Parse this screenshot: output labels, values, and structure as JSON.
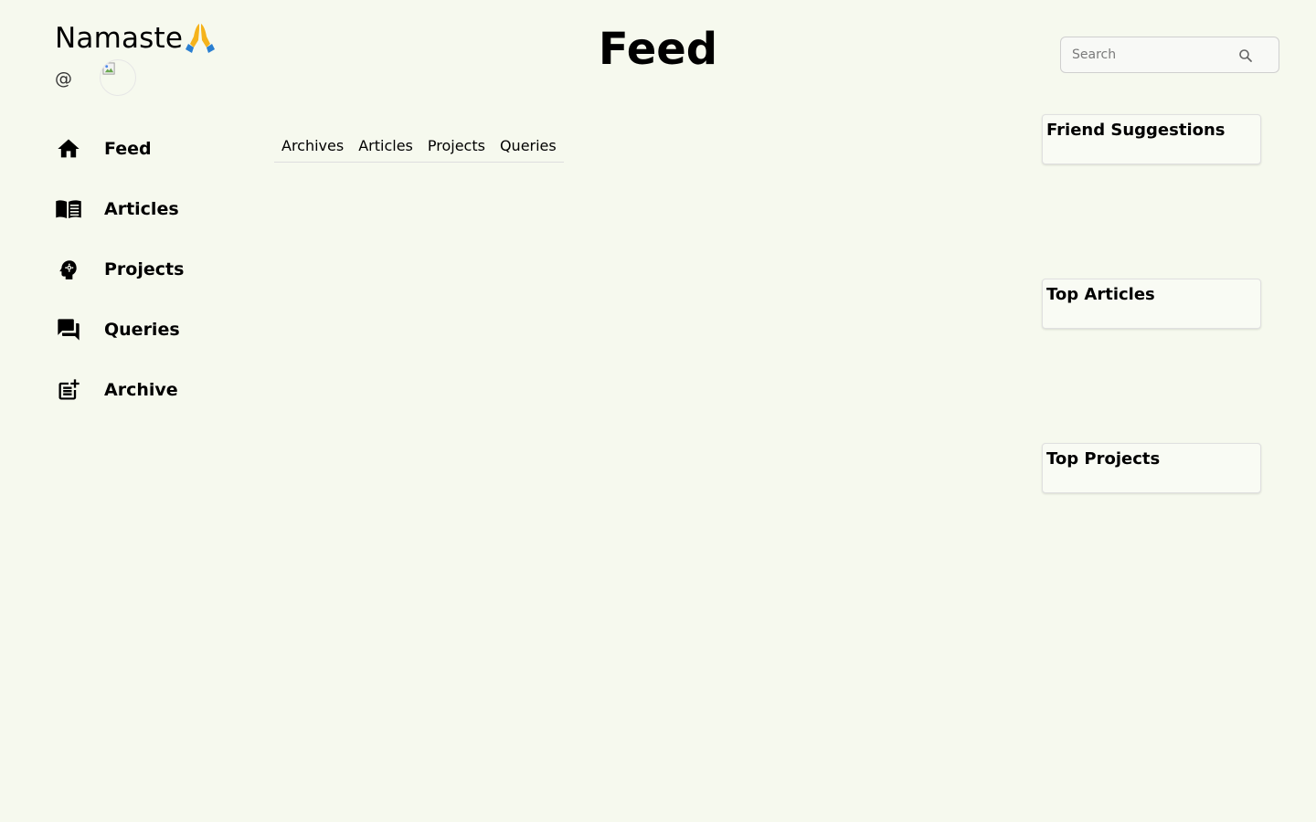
{
  "header": {
    "greeting": "Namaste",
    "handle_prefix": "@",
    "title": "Feed"
  },
  "search": {
    "placeholder": "Search",
    "value": ""
  },
  "sidebar": {
    "items": [
      {
        "label": "Feed",
        "icon": "home-icon"
      },
      {
        "label": "Articles",
        "icon": "menu-book-icon"
      },
      {
        "label": "Projects",
        "icon": "psychology-head-icon"
      },
      {
        "label": "Queries",
        "icon": "forum-icon"
      },
      {
        "label": "Archive",
        "icon": "post-add-icon"
      }
    ]
  },
  "tabs": [
    {
      "label": "Archives"
    },
    {
      "label": "Articles"
    },
    {
      "label": "Projects"
    },
    {
      "label": "Queries"
    }
  ],
  "widgets": {
    "friend_suggestions": {
      "title": "Friend Suggestions"
    },
    "top_articles": {
      "title": "Top Articles"
    },
    "top_projects": {
      "title": "Top Projects"
    }
  },
  "colors": {
    "background": "#f6f9ee",
    "text": "#000000",
    "emoji_hands": "#f5b31b",
    "emoji_cuffs": "#2a7fd1"
  }
}
